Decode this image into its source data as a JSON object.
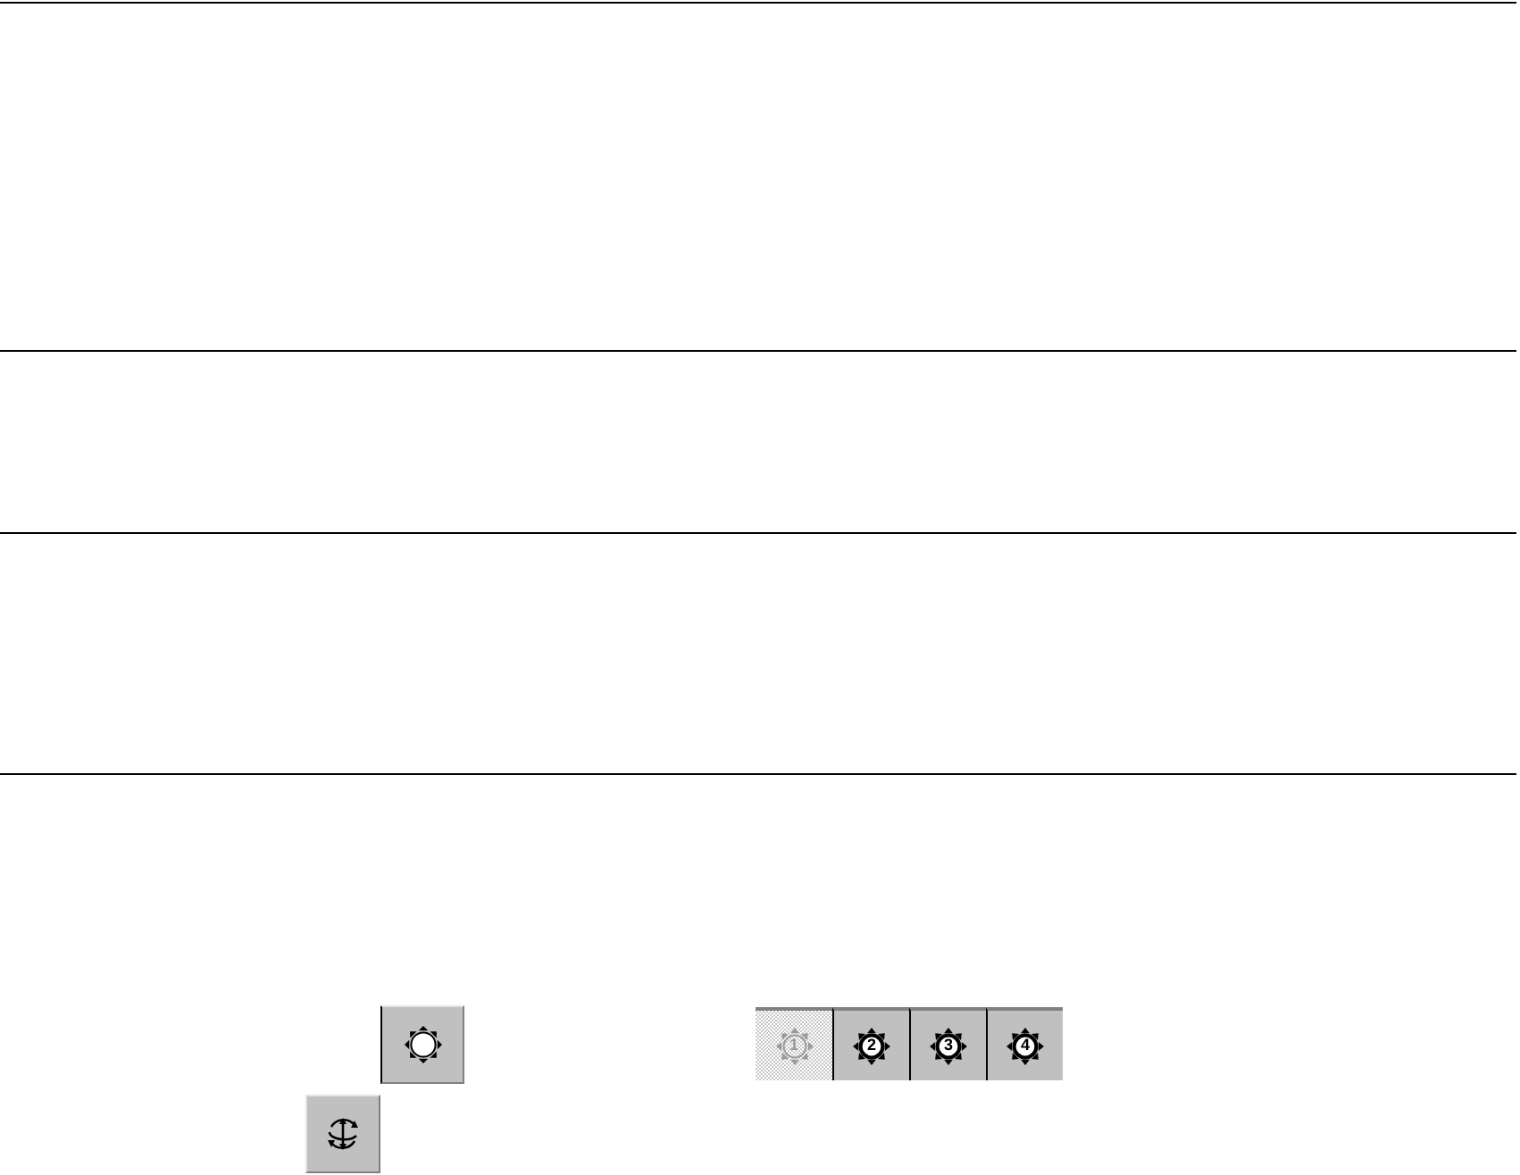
{
  "numbered_buttons": [
    {
      "label": "1",
      "selected": true
    },
    {
      "label": "2",
      "selected": false
    },
    {
      "label": "3",
      "selected": false
    },
    {
      "label": "4",
      "selected": false
    }
  ]
}
